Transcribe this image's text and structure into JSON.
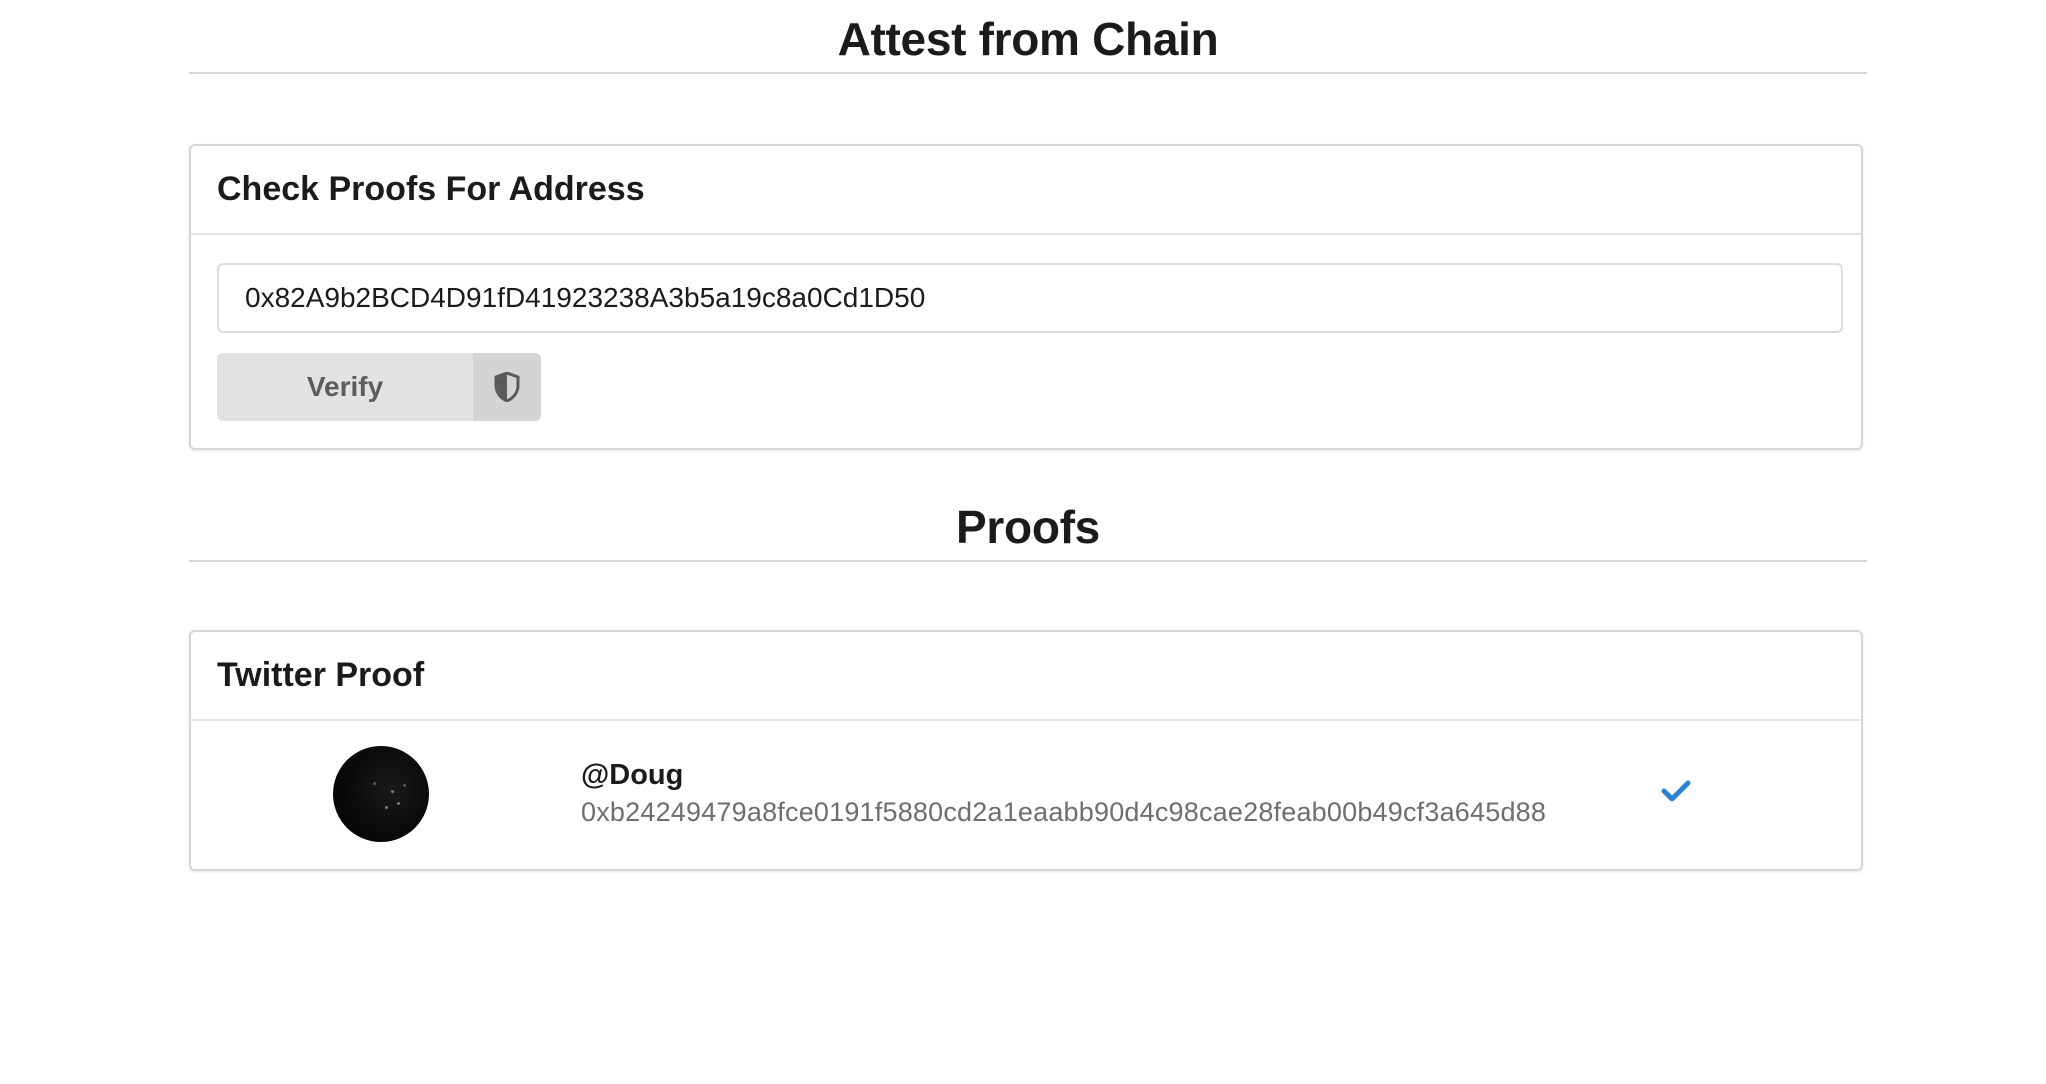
{
  "headings": {
    "attest": "Attest from Chain",
    "proofs": "Proofs"
  },
  "check_card": {
    "title": "Check Proofs For Address",
    "address_value": "0x82A9b2BCD4D91fD41923238A3b5a19c8a0Cd1D50",
    "verify_label": "Verify",
    "verify_icon": "shield-icon"
  },
  "proof_card": {
    "title": "Twitter Proof",
    "items": [
      {
        "handle": "@Doug",
        "hash": "0xb24249479a8fce0191f5880cd2a1eaabb90d4c98cae28feab00b49cf3a645d88",
        "status_icon": "check-icon",
        "status_color": "#2b7fd4"
      }
    ]
  }
}
